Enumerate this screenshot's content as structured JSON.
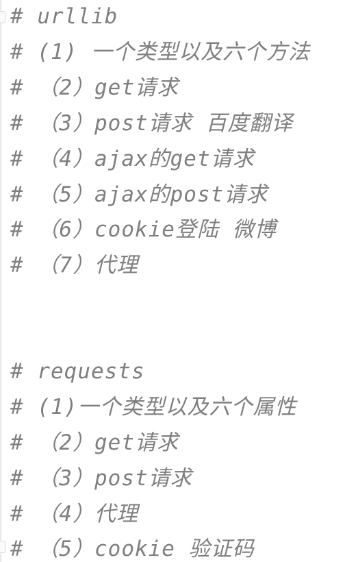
{
  "editor": {
    "lines": [
      "# urllib",
      "# (1) 一个类型以及六个方法",
      "# （2）get请求",
      "# （3）post请求     百度翻译",
      "# （4）ajax的get请求",
      "# （5）ajax的post请求",
      "# （6）cookie登陆 微博",
      "# （7）代理",
      "",
      "",
      "# requests",
      "# (1)一个类型以及六个属性",
      "# （2）get请求",
      "# （3）post请求",
      "# （4）代理",
      "# （5）cookie   验证码"
    ]
  },
  "colors": {
    "comment": "#7f7f7f",
    "background": "#ffffff",
    "gutter": "#e9e9e9"
  }
}
